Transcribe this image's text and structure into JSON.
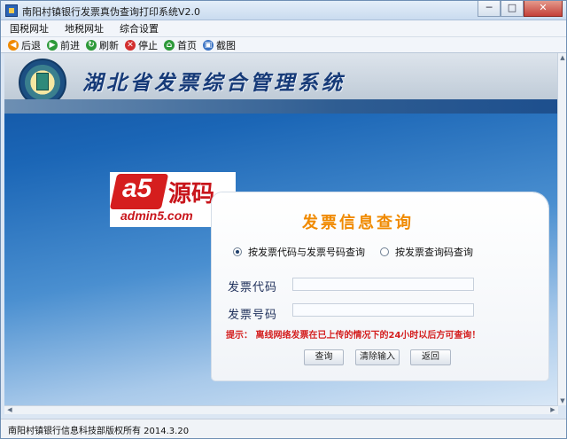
{
  "window": {
    "title": "南阳村镇银行发票真伪查询打印系统V2.0",
    "minimize": "─",
    "maximize": "□",
    "close": "✕"
  },
  "menu": [
    "国税网址",
    "地税网址",
    "综合设置"
  ],
  "toolbar": [
    {
      "label": "后退",
      "icon": "back-arrow-icon",
      "color": "#f08a00",
      "glyph": "◀"
    },
    {
      "label": "前进",
      "icon": "forward-arrow-icon",
      "color": "#2e9a3a",
      "glyph": "▶"
    },
    {
      "label": "刷新",
      "icon": "refresh-icon",
      "color": "#2e9a3a",
      "glyph": "↻"
    },
    {
      "label": "停止",
      "icon": "stop-icon",
      "color": "#d32f2f",
      "glyph": "✕"
    },
    {
      "label": "首页",
      "icon": "home-icon",
      "color": "#2e9a3a",
      "glyph": "⌂"
    },
    {
      "label": "截图",
      "icon": "screenshot-icon",
      "color": "#3b73c4",
      "glyph": "▣"
    }
  ],
  "header": {
    "system_title": "湖北省发票综合管理系统"
  },
  "watermark": {
    "logo_text": "a5",
    "logo_cn": "源码",
    "logo_url": "admin5.com"
  },
  "query": {
    "title": "发票信息查询",
    "radio_options": [
      {
        "label": "按发票代码与发票号码查询",
        "selected": true
      },
      {
        "label": "按发票查询码查询",
        "selected": false
      }
    ],
    "fields": [
      {
        "label": "发票代码",
        "value": ""
      },
      {
        "label": "发票号码",
        "value": ""
      }
    ],
    "hint": "提示：  离线网络发票在已上传的情况下的24小时以后方可查询！",
    "buttons": [
      "查询",
      "清除输入",
      "返回"
    ]
  },
  "status": {
    "text": "南阳村镇银行信息科技部版权所有  2014.3.20"
  },
  "colors": {
    "accent_orange": "#f08a00",
    "hint_red": "#d41f1f",
    "title_blue": "#163a78"
  }
}
